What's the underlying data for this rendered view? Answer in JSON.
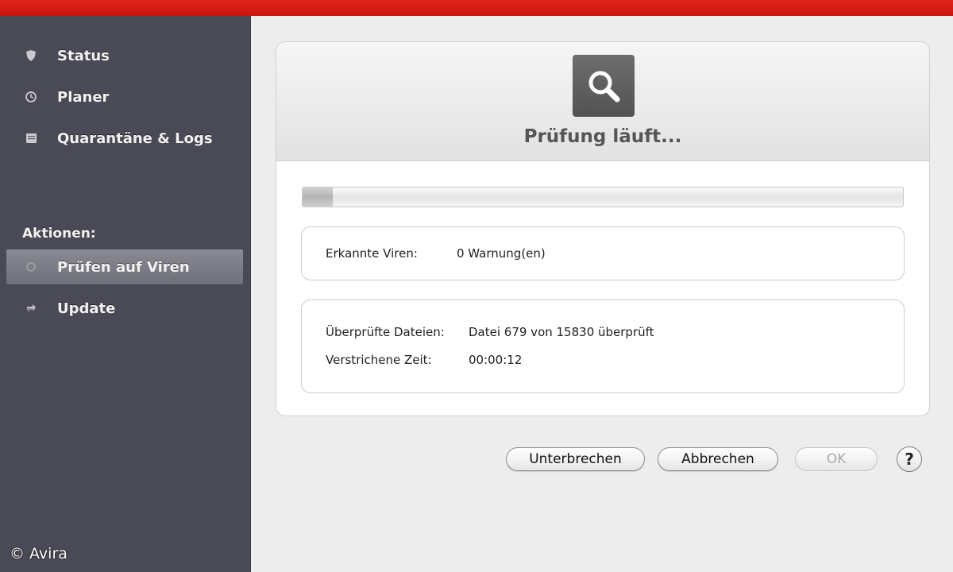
{
  "sidebar": {
    "items": [
      {
        "label": "Status",
        "icon": "shield-icon"
      },
      {
        "label": "Planer",
        "icon": "clock-icon"
      },
      {
        "label": "Quarantäne & Logs",
        "icon": "log-icon"
      }
    ],
    "section_label": "Aktionen:",
    "actions": [
      {
        "label": "Prüfen auf Viren",
        "icon": "scan-icon",
        "selected": true
      },
      {
        "label": "Update",
        "icon": "update-icon",
        "selected": false
      }
    ],
    "copyright": "© Avira"
  },
  "scan": {
    "title": "Prüfung läuft...",
    "icon": "magnifier-icon",
    "progress_fraction": 0.05,
    "detected_label": "Erkannte Viren:",
    "detected_value": "0 Warnung(en)",
    "files_label": "Überprüfte Dateien:",
    "files_value": "Datei 679 von 15830 überprüft",
    "time_label": "Verstrichene Zeit:",
    "time_value": "00:00:12"
  },
  "buttons": {
    "pause": "Unterbrechen",
    "cancel": "Abbrechen",
    "ok": "OK",
    "help": "?"
  },
  "colors": {
    "titlebar": "#d81e16",
    "sidebar": "#4a4a56",
    "selected": "#7a7a85"
  }
}
